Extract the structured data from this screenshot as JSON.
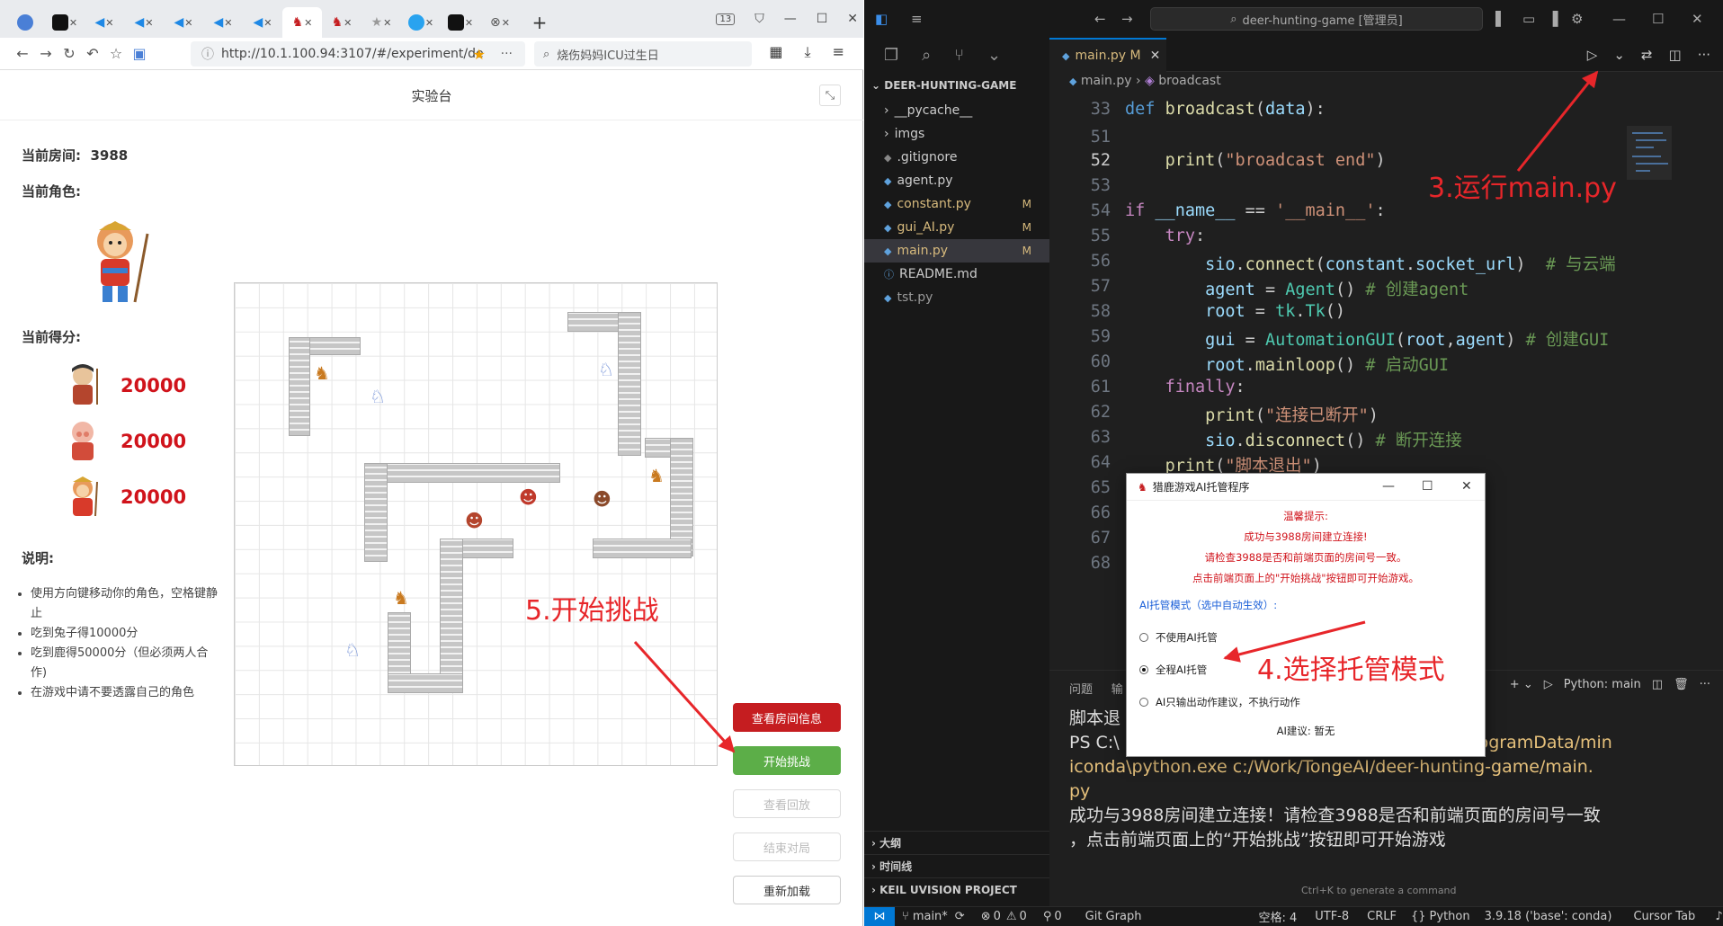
{
  "browser": {
    "tab_count_badge": "13",
    "url": "http://10.1.100.94:3107/#/experiment/de",
    "search_text": "烧伤妈妈ICU过生日",
    "page_title": "实验台",
    "room_label": "当前房间:",
    "room_value": "3988",
    "role_label": "当前角色:",
    "score_label": "当前得分:",
    "scores": [
      "20000",
      "20000",
      "20000"
    ],
    "desc_label": "说明:",
    "desc_items": [
      "使用方向键移动你的角色，空格键静止",
      "吃到兔子得10000分",
      "吃到鹿得50000分（但必须两人合作)",
      "在游戏中请不要透露自己的角色"
    ],
    "buttons": {
      "room_info": "查看房间信息",
      "start": "开始挑战",
      "replay": "查看回放",
      "end": "结束对局",
      "reload": "重新加载"
    },
    "annotation": "5.开始挑战"
  },
  "vscode": {
    "search": "deer-hunting-game [管理员]",
    "explorer_title": "DEER-HUNTING-GAME",
    "files": [
      {
        "name": "__pycache__",
        "icon": "chevron-right",
        "status": ""
      },
      {
        "name": "imgs",
        "icon": "chevron-right",
        "status": ""
      },
      {
        "name": ".gitignore",
        "icon": "",
        "status": ""
      },
      {
        "name": "agent.py",
        "icon": "python",
        "status": ""
      },
      {
        "name": "constant.py",
        "icon": "python",
        "status": "M"
      },
      {
        "name": "gui_AI.py",
        "icon": "python",
        "status": "M"
      },
      {
        "name": "main.py",
        "icon": "python",
        "status": "M"
      },
      {
        "name": "README.md",
        "icon": "info",
        "status": ""
      },
      {
        "name": "tst.py",
        "icon": "python",
        "status": ""
      }
    ],
    "sections": [
      "大纲",
      "时间线",
      "KEIL UVISION PROJECT"
    ],
    "tab_name": "main.py M",
    "breadcrumb_file": "main.py",
    "breadcrumb_symbol": "broadcast",
    "annotation_run": "3.运行main.py",
    "panel_tabs": [
      "问题",
      "输"
    ],
    "terminal_label": "Python: main",
    "terminal_lines": [
      "脚本退",
      "PS C:\\",
      "iconda\\python.exe c:/Work/TongeAI/deer-hunting-game/main.",
      "py",
      "成功与3988房间建立连接！请检查3988是否和前端页面的房间号一致",
      "，点击前端页面上的“开始挑战”按钮即可开始游戏"
    ],
    "terminal_path_tail": "C:/ProgramData/min",
    "ctrlk_hint": "Ctrl+K to generate a command",
    "status": {
      "branch": "main*",
      "errors": "0",
      "warnings": "0",
      "ports": "0",
      "git_graph": "Git Graph",
      "spaces": "空格: 4",
      "encoding": "UTF-8",
      "eol": "CRLF",
      "language": "Python",
      "interpreter": "3.9.18 ('base': conda)",
      "cursor_tab": "Cursor Tab"
    }
  },
  "dialog": {
    "title": "猎鹿游戏AI托管程序",
    "warn_title": "温馨提示:",
    "warn_lines": [
      "成功与3988房间建立连接!",
      "请检查3988是否和前端页面的房间号一致。",
      "点击前端页面上的\"开始挑战\"按钮即可开始游戏。"
    ],
    "mode_label": "AI托管模式（选中自动生效）:",
    "options": [
      "不使用AI托管",
      "全程AI托管",
      "AI只输出动作建议，不执行动作"
    ],
    "selected": 1,
    "suggestion": "AI建议: 暂无",
    "annotation": "4.选择托管模式"
  },
  "colors": {
    "accent_red": "#e7262a",
    "score_red": "#d0131b",
    "start_green": "#5cae48",
    "vscode_blue": "#0078d4"
  }
}
